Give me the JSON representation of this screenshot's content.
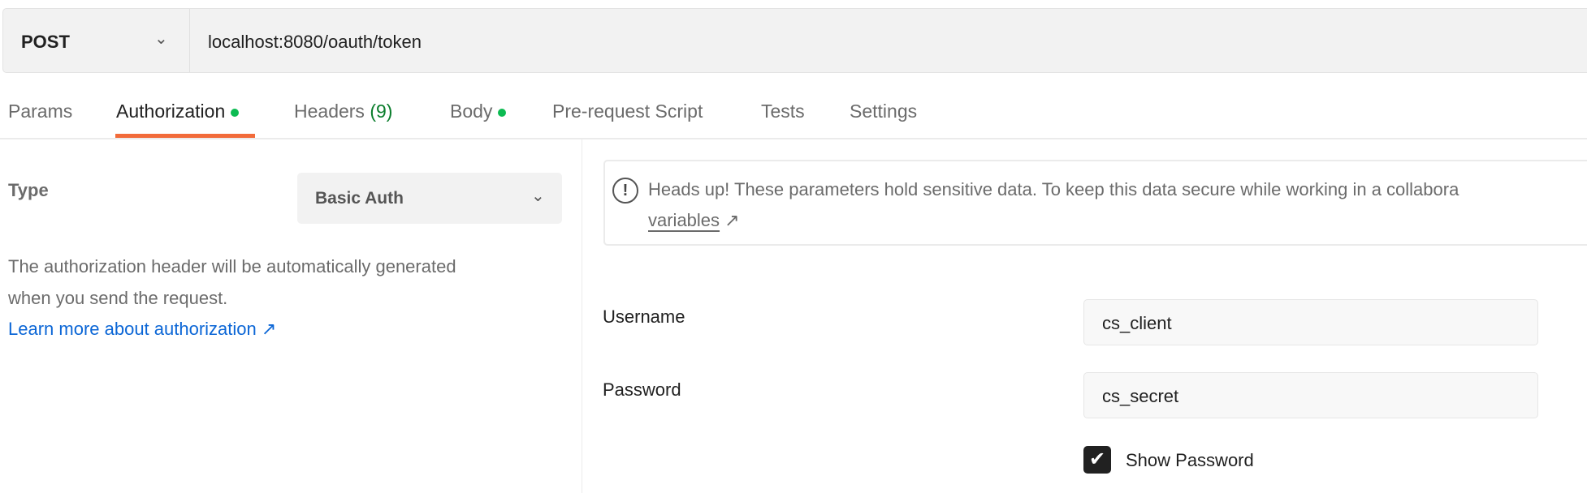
{
  "request": {
    "method": "POST",
    "url": "localhost:8080/oauth/token"
  },
  "tabs": [
    {
      "label": "Params"
    },
    {
      "label": "Authorization",
      "dot": true,
      "active": true
    },
    {
      "label": "Headers",
      "count": "(9)"
    },
    {
      "label": "Body",
      "dot": true
    },
    {
      "label": "Pre-request Script"
    },
    {
      "label": "Tests"
    },
    {
      "label": "Settings"
    }
  ],
  "auth": {
    "type_label": "Type",
    "type_value": "Basic Auth",
    "description_line1": "The authorization header will be automatically generated",
    "description_line2": "when you send the request.",
    "learn_more": "Learn more about authorization ↗"
  },
  "alert": {
    "text": "Heads up! These parameters hold sensitive data. To keep this data secure while working in a collabora",
    "link": "variables",
    "link_arrow": "↗"
  },
  "fields": {
    "username_label": "Username",
    "username_value": "cs_client",
    "password_label": "Password",
    "password_value": "cs_secret",
    "show_password_label": "Show Password",
    "show_password_checked": true
  },
  "colors": {
    "accent": "#f26b3a",
    "dot": "#0cbb52",
    "link": "#0b66d6",
    "count": "#0a7d2c"
  }
}
